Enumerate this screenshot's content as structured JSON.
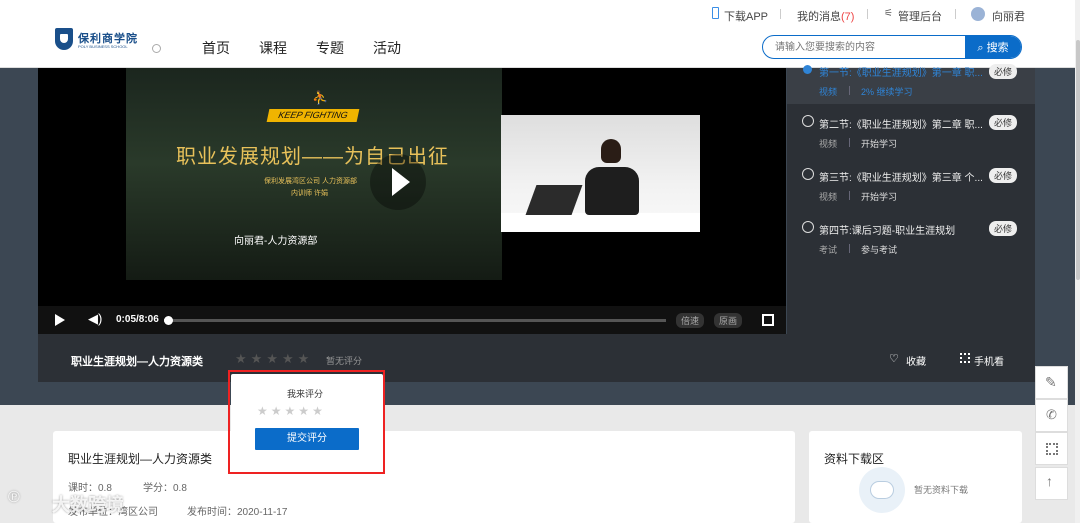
{
  "header": {
    "logo_text": "保利商学院",
    "logo_sub": "POLY BUSINESS SCHOOL",
    "nav": [
      "首页",
      "课程",
      "专题",
      "活动"
    ],
    "download_app": "下载APP",
    "messages": "我的消息",
    "messages_count": "(7)",
    "admin": "管理后台",
    "username": "向丽君",
    "search_placeholder": "请输入您要搜索的内容",
    "search_button": "搜索"
  },
  "video": {
    "slide_tag": "KEEP FIGHTING",
    "slide_title": "职业发展规划——为自己出征",
    "slide_line1": "保利发展湾区公司 人力资源部",
    "slide_line2": "内训师 许娟",
    "slide_presenter": "向丽君-人力资源部",
    "time": "0:05/8:06",
    "progress": 0.01,
    "speed": "倍速",
    "quality": "原画"
  },
  "playlist": [
    {
      "title": "第一节:《职业生涯规划》第一章 职...",
      "type": "视频",
      "action": "2% 继续学习",
      "badge": "必修"
    },
    {
      "title": "第二节:《职业生涯规划》第二章 职...",
      "type": "视频",
      "action": "开始学习",
      "badge": "必修"
    },
    {
      "title": "第三节:《职业生涯规划》第三章 个...",
      "type": "视频",
      "action": "开始学习",
      "badge": "必修"
    },
    {
      "title": "第四节:课后习题-职业生涯规划",
      "type": "考试",
      "action": "参与考试",
      "badge": "必修"
    }
  ],
  "course": {
    "title": "职业生涯规划—人力资源类",
    "rating_text": "暂无评分",
    "favorite": "收藏",
    "mobile_view": "手机看"
  },
  "rating_popup": {
    "label": "我来评分",
    "submit": "提交评分"
  },
  "detail": {
    "title": "职业生涯规划—人力资源类",
    "hours": "课时：0.8",
    "credits": "学分：0.8",
    "org": "发布单位：",
    "org_value": "湾区公司",
    "date": "发布时间：2020-11-17"
  },
  "downloads": {
    "title": "资料下载区",
    "empty": "暂无资料下载"
  },
  "watermark": "大数跨境"
}
